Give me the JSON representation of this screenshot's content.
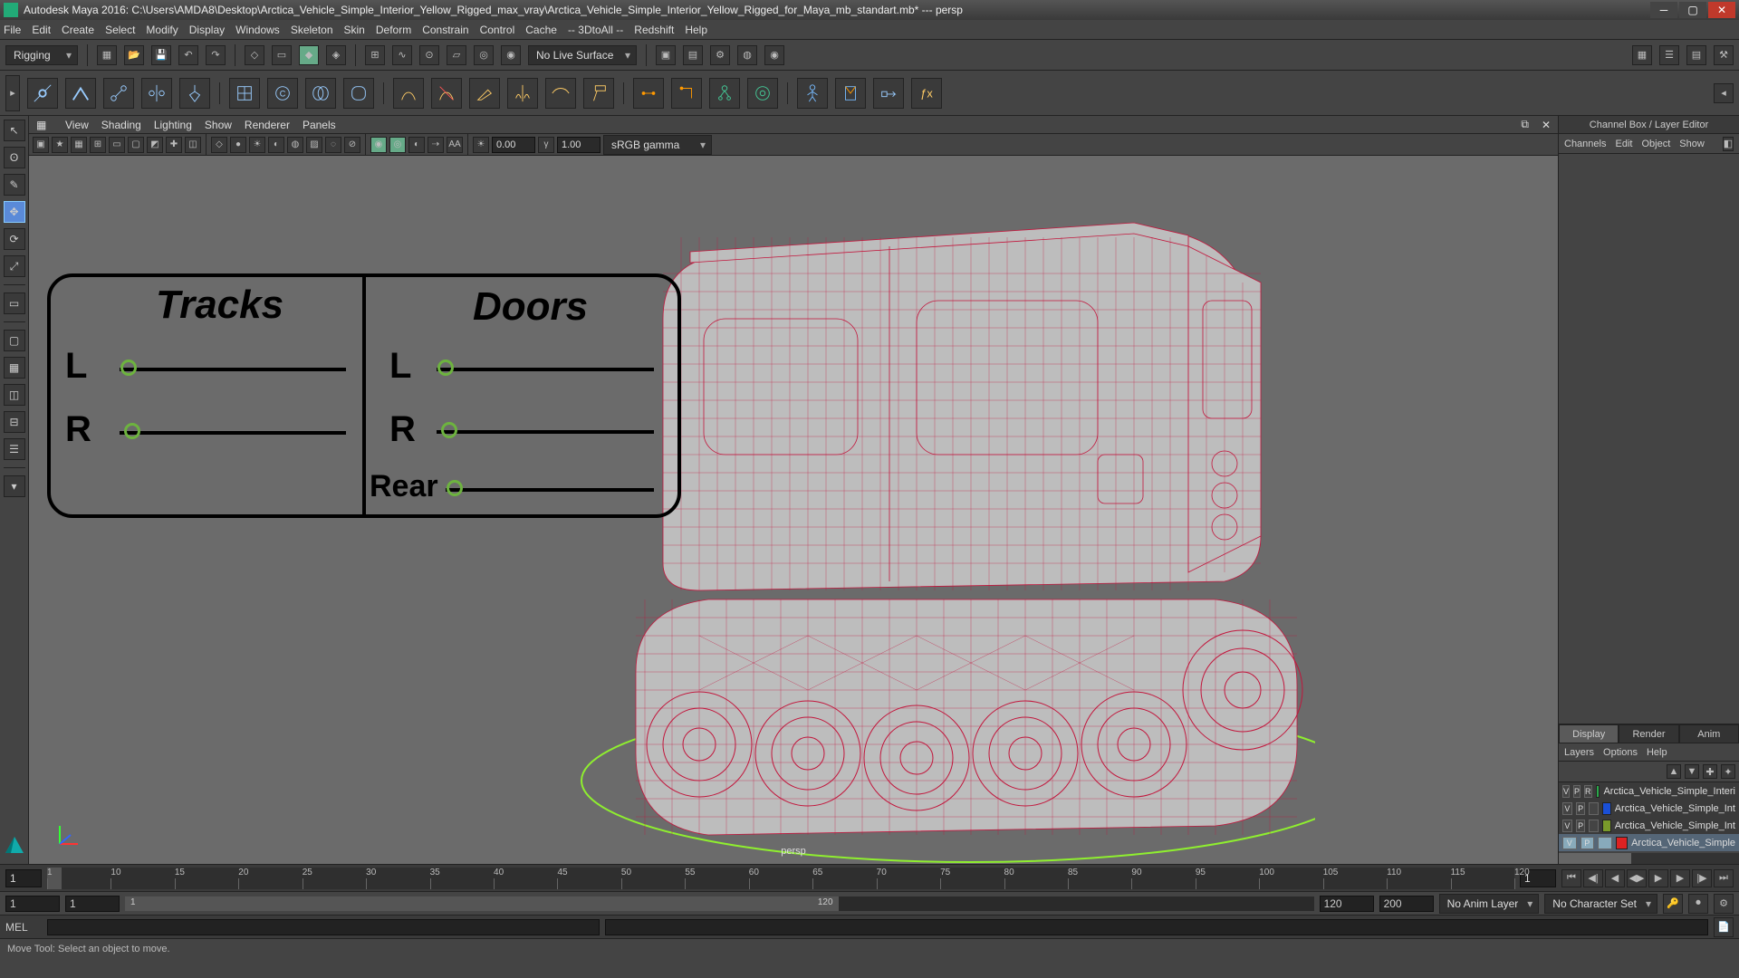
{
  "title": "Autodesk Maya 2016: C:\\Users\\AMDA8\\Desktop\\Arctica_Vehicle_Simple_Interior_Yellow_Rigged_max_vray\\Arctica_Vehicle_Simple_Interior_Yellow_Rigged_for_Maya_mb_standart.mb*   ---   persp",
  "menus": [
    "File",
    "Edit",
    "Create",
    "Select",
    "Modify",
    "Display",
    "Windows",
    "Skeleton",
    "Skin",
    "Deform",
    "Constrain",
    "Control",
    "Cache",
    "-- 3DtoAll --",
    "Redshift",
    "Help"
  ],
  "shelf": {
    "mode": "Rigging",
    "live_surface": "No Live Surface"
  },
  "panel_menus": [
    "View",
    "Shading",
    "Lighting",
    "Show",
    "Renderer",
    "Panels"
  ],
  "vp": {
    "val_a": "0.00",
    "val_b": "1.00",
    "color_mode": "sRGB gamma",
    "camera": "persp"
  },
  "rig": {
    "tracks_title": "Tracks",
    "doors_title": "Doors",
    "L": "L",
    "R": "R",
    "Rear": "Rear"
  },
  "channel_box": {
    "title": "Channel Box / Layer Editor",
    "tabs": [
      "Channels",
      "Edit",
      "Object",
      "Show"
    ],
    "layer_tabs": [
      "Display",
      "Render",
      "Anim"
    ],
    "layer_menus": [
      "Layers",
      "Options",
      "Help"
    ],
    "layers": [
      {
        "V": "V",
        "P": "P",
        "R": "R",
        "color": "#2aa84a",
        "name": "Arctica_Vehicle_Simple_Interi"
      },
      {
        "V": "V",
        "P": "P",
        "R": "",
        "color": "#1a4fd6",
        "name": "Arctica_Vehicle_Simple_Int"
      },
      {
        "V": "V",
        "P": "P",
        "R": "",
        "color": "#7a9a2a",
        "name": "Arctica_Vehicle_Simple_Int"
      },
      {
        "V": "V",
        "P": "P",
        "R": "",
        "color": "#d22",
        "name": "Arctica_Vehicle_Simple",
        "selected": true
      }
    ]
  },
  "timeline": {
    "start": "1",
    "end": "1",
    "display_start": "1",
    "cur": "1",
    "ticks": [
      "1",
      "10",
      "15",
      "20",
      "25",
      "30",
      "35",
      "40",
      "45",
      "50",
      "55",
      "60",
      "65",
      "70",
      "75",
      "80",
      "85",
      "90",
      "95",
      "100",
      "105",
      "110",
      "115",
      "120"
    ],
    "range_start": "1",
    "range_end": "120",
    "anim_start": "120",
    "anim_end": "200",
    "anim_layer": "No Anim Layer",
    "char_set": "No Character Set"
  },
  "cmd": {
    "label": "MEL"
  },
  "status": "Move Tool: Select an object to move."
}
